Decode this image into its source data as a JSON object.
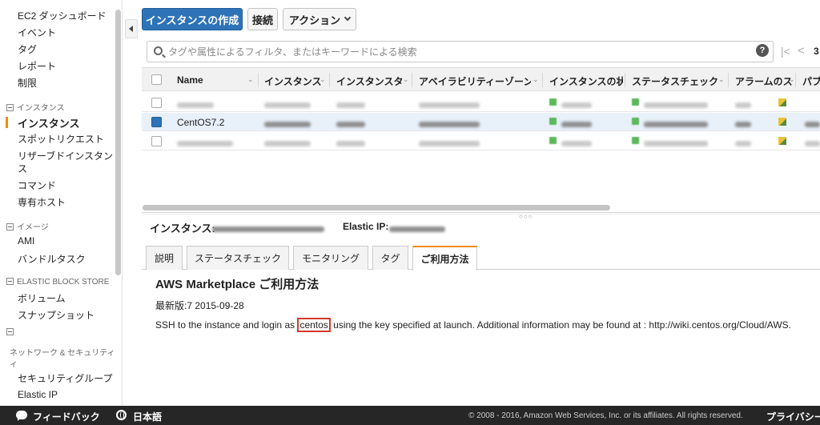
{
  "sidebar": {
    "items": [
      {
        "label": "EC2 ダッシュボード"
      },
      {
        "label": "イベント"
      },
      {
        "label": "タグ"
      },
      {
        "label": "レポート"
      },
      {
        "label": "制限"
      }
    ],
    "sections": {
      "instances": "インスタンス",
      "images": "イメージ",
      "ebs": "ELASTIC BLOCK STORE",
      "network": "ネットワーク & セキュリティ"
    },
    "instance_items": [
      {
        "label": "インスタンス",
        "active": true
      },
      {
        "label": "スポットリクエスト"
      },
      {
        "label": "リザーブドインスタン"
      },
      {
        "label": "ス"
      },
      {
        "label": "コマンド"
      },
      {
        "label": "専有ホスト"
      }
    ],
    "image_items": [
      {
        "label": "AMI"
      },
      {
        "label": "バンドルタスク"
      }
    ],
    "ebs_items": [
      {
        "label": "ボリューム"
      },
      {
        "label": "スナップショット"
      }
    ],
    "network_items": [
      {
        "label": "セキュリティグループ"
      },
      {
        "label": "Elastic IP"
      }
    ],
    "network_wrap": "ィ"
  },
  "toolbar": {
    "create_label": "インスタンスの作成",
    "connect_label": "接続",
    "actions_label": "アクション"
  },
  "search": {
    "placeholder": "タグや属性によるフィルタ、またはキーワードによる検索",
    "value": ""
  },
  "pager": {
    "count": "3"
  },
  "table": {
    "columns": [
      "Name",
      "インスタンス",
      "インスタンスタ",
      "アベイラビリティーゾーン",
      "インスタンスの状",
      "ステータスチェック",
      "アラームのス",
      "パブ"
    ],
    "rows": [
      {
        "name": "",
        "selected": false
      },
      {
        "name": "CentOS7.2",
        "selected": true
      },
      {
        "name": "",
        "selected": false
      }
    ]
  },
  "details": {
    "instance_label": "インスタンス:",
    "eip_label": "Elastic IP:",
    "tabs": [
      "説明",
      "ステータスチェック",
      "モニタリング",
      "タグ",
      "ご利用方法"
    ],
    "active_tab": "ご利用方法",
    "mp_title": "AWS Marketplace ご利用方法",
    "mp_version": "最新版:7 2015-09-28",
    "mp_instr_before": "SSH to the instance and login as ",
    "mp_user": "centos",
    "mp_instr_after": " using the key specified at launch. Additional information may be found at : http://wiki.centos.org/Cloud/AWS."
  },
  "footer": {
    "feedback": "フィードバック",
    "language": "日本語",
    "copyright": "© 2008 - 2016, Amazon Web Services, Inc. or its affiliates. All rights reserved.",
    "privacy": "プライバシーポ"
  },
  "colors": {
    "primary_button": "#2e73b8",
    "active_accent": "#f08c00",
    "highlight_border": "#d23a2a",
    "footer_bg": "#262626"
  }
}
